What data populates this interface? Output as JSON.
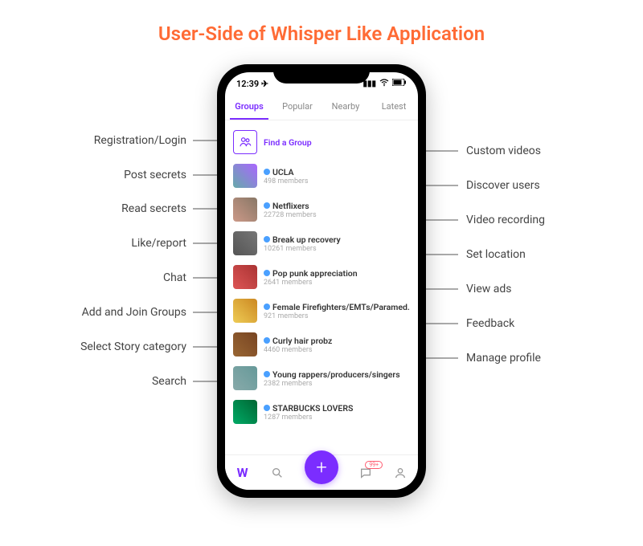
{
  "title": "User-Side of Whisper Like Application",
  "statusbar": {
    "time": "12:39"
  },
  "tabs": [
    "Groups",
    "Popular",
    "Nearby",
    "Latest"
  ],
  "find_group": "Find a Group",
  "groups": [
    {
      "name": "UCLA",
      "members": "498 members"
    },
    {
      "name": "Netflixers",
      "members": "22728 members"
    },
    {
      "name": "Break up recovery",
      "members": "10261 members"
    },
    {
      "name": "Pop punk appreciation",
      "members": "2641 members"
    },
    {
      "name": "Female Firefighters/EMTs/Paramed...",
      "members": "921 members"
    },
    {
      "name": "Curly hair probz",
      "members": "4460 members"
    },
    {
      "name": "Young rappers/producers/singers",
      "members": "2382 members"
    },
    {
      "name": "STARBUCKS LOVERS",
      "members": "1287 members"
    }
  ],
  "fab": "+",
  "badge": "99+",
  "callouts": {
    "left": [
      "Registration/Login",
      "Post secrets",
      "Read secrets",
      "Like/report",
      "Chat",
      "Add and Join Groups",
      "Select Story category",
      "Search"
    ],
    "right": [
      "Custom videos",
      "Discover users",
      "Video recording",
      "Set location",
      "View ads",
      "Feedback",
      "Manage profile"
    ]
  }
}
